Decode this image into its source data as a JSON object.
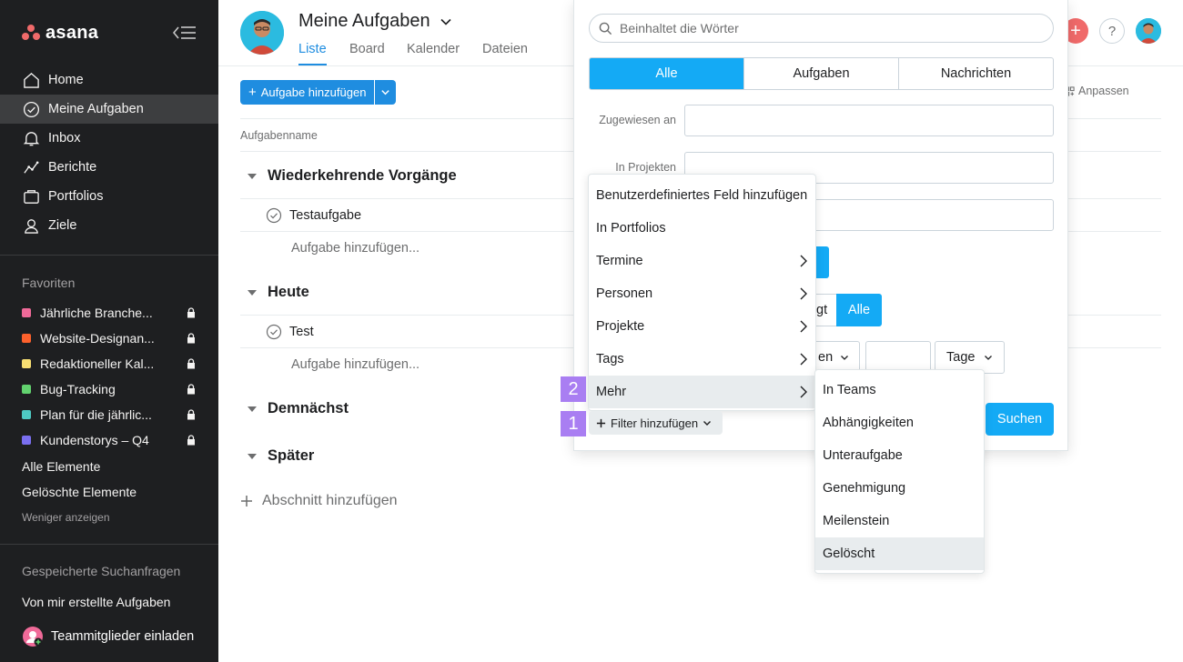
{
  "app": {
    "logo_text": "asana"
  },
  "sidebar": {
    "nav": [
      {
        "label": "Home",
        "icon": "home-icon"
      },
      {
        "label": "Meine Aufgaben",
        "icon": "check-circle-icon",
        "active": true
      },
      {
        "label": "Inbox",
        "icon": "bell-icon"
      },
      {
        "label": "Berichte",
        "icon": "chart-line-icon"
      },
      {
        "label": "Portfolios",
        "icon": "folder-icon"
      },
      {
        "label": "Ziele",
        "icon": "person-icon"
      }
    ],
    "favorites_heading": "Favoriten",
    "favorites": [
      {
        "label": "Jährliche Branche...",
        "color": "#f06a99"
      },
      {
        "label": "Website-Designan...",
        "color": "#fd612c"
      },
      {
        "label": "Redaktioneller Kal...",
        "color": "#f8df72"
      },
      {
        "label": "Bug-Tracking",
        "color": "#62d26f"
      },
      {
        "label": "Plan für die jährlic...",
        "color": "#4ecbc4"
      },
      {
        "label": "Kundenstorys – Q4",
        "color": "#7a6ff0"
      }
    ],
    "all_elements": "Alle Elemente",
    "deleted_elements": "Gelöschte Elemente",
    "show_less": "Weniger anzeigen",
    "saved_searches_heading": "Gespeicherte Suchanfragen",
    "saved_search_item": "Von mir erstellte Aufgaben",
    "invite": "Teammitglieder einladen"
  },
  "header": {
    "title": "Meine Aufgaben",
    "tabs": [
      "Liste",
      "Board",
      "Kalender",
      "Dateien"
    ],
    "active_tab": "Liste"
  },
  "toolbar": {
    "add_task": "Aufgabe hinzufügen",
    "customize": "Anpassen"
  },
  "list": {
    "column_header": "Aufgabenname",
    "sections": [
      {
        "title": "Wiederkehrende Vorgänge",
        "tasks": [
          "Testaufgabe"
        ],
        "add_task": "Aufgabe hinzufügen..."
      },
      {
        "title": "Heute",
        "tasks": [
          "Test"
        ],
        "add_task": "Aufgabe hinzufügen..."
      },
      {
        "title": "Demnächst",
        "tasks": []
      },
      {
        "title": "Später",
        "tasks": []
      }
    ],
    "add_section": "Abschnitt hinzufügen"
  },
  "search_panel": {
    "placeholder": "Beinhaltet die Wörter",
    "segments": [
      "Alle",
      "Aufgaben",
      "Nachrichten"
    ],
    "active_segment": "Alle",
    "assigned_label": "Zugewiesen an",
    "projects_label": "In Projekten",
    "status_fragment": "gt",
    "status_all": "Alle",
    "date_fragment": "en",
    "days_label": "Tage",
    "search_button": "Suchen",
    "add_filter": "Filter hinzufügen"
  },
  "filter_menu": {
    "items": [
      {
        "label": "Benutzerdefiniertes Feld hinzufügen",
        "submenu": false
      },
      {
        "label": "In Portfolios",
        "submenu": false
      },
      {
        "label": "Termine",
        "submenu": true
      },
      {
        "label": "Personen",
        "submenu": true
      },
      {
        "label": "Projekte",
        "submenu": true
      },
      {
        "label": "Tags",
        "submenu": true
      },
      {
        "label": "Mehr",
        "submenu": true,
        "hover": true
      }
    ]
  },
  "more_submenu": {
    "items": [
      "In Teams",
      "Abhängigkeiten",
      "Unteraufgabe",
      "Genehmigung",
      "Meilenstein",
      "Gelöscht"
    ],
    "hover": "Gelöscht"
  },
  "step_badges": [
    "1",
    "2"
  ],
  "colors": {
    "accent": "#14aaf5",
    "sidebar_bg": "#1e1f21",
    "badge": "#a97ef2"
  }
}
